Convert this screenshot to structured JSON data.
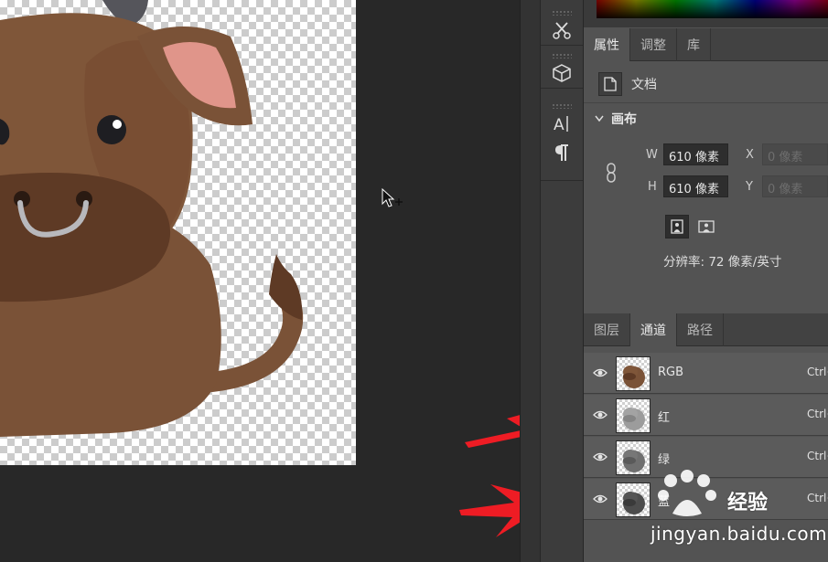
{
  "properties_tabs": [
    {
      "label": "属性",
      "active": true
    },
    {
      "label": "调整",
      "active": false
    },
    {
      "label": "库",
      "active": false
    }
  ],
  "document": {
    "label": "文档",
    "icon": "document-icon"
  },
  "canvas": {
    "title": "画布",
    "width_label": "W",
    "width_value": "610 像素",
    "height_label": "H",
    "height_value": "610 像素",
    "x_label": "X",
    "x_value": "0 像素",
    "y_label": "Y",
    "y_value": "0 像素",
    "resolution": "分辨率: 72 像素/英寸"
  },
  "channel_tabs": [
    {
      "label": "图层",
      "active": false
    },
    {
      "label": "通道",
      "active": true
    },
    {
      "label": "路径",
      "active": false
    }
  ],
  "channels": [
    {
      "name": "RGB",
      "shortcut": "Ctrl+"
    },
    {
      "name": "红",
      "shortcut": "Ctrl+"
    },
    {
      "name": "绿",
      "shortcut": "Ctrl+"
    },
    {
      "name": "蓝",
      "shortcut": "Ctrl+"
    }
  ],
  "tools": [
    "tool-preset-icon",
    "3d-cube-icon",
    "character-icon",
    "paragraph-icon"
  ],
  "colors": {
    "annotation_arrow": "#ee1c24",
    "cow_body": "#7a5237",
    "cow_muzzle": "#5e3a25",
    "ear_inner": "#e0958a"
  },
  "watermark": {
    "brand": "经验",
    "url": "jingyan.baidu.com"
  }
}
